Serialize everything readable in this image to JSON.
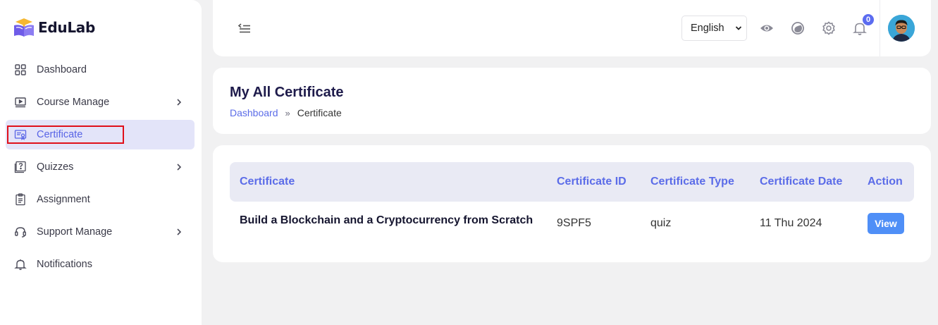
{
  "brand": {
    "name": "EduLab"
  },
  "sidebar": {
    "items": [
      {
        "label": "Dashboard",
        "icon": "grid-icon",
        "has_submenu": false,
        "active": false
      },
      {
        "label": "Course Manage",
        "icon": "play-screen-icon",
        "has_submenu": true,
        "active": false
      },
      {
        "label": "Certificate",
        "icon": "certificate-icon",
        "has_submenu": false,
        "active": true
      },
      {
        "label": "Quizzes",
        "icon": "quiz-icon",
        "has_submenu": true,
        "active": false
      },
      {
        "label": "Assignment",
        "icon": "clipboard-icon",
        "has_submenu": false,
        "active": false
      },
      {
        "label": "Support Manage",
        "icon": "headset-icon",
        "has_submenu": true,
        "active": false
      },
      {
        "label": "Notifications",
        "icon": "bell-icon",
        "has_submenu": false,
        "active": false
      }
    ]
  },
  "header": {
    "language": {
      "selected": "English"
    },
    "notifications_count": "0"
  },
  "page": {
    "title": "My All Certificate",
    "breadcrumb": {
      "home": "Dashboard",
      "separator": "»",
      "current": "Certificate"
    }
  },
  "table": {
    "columns": [
      "Certificate",
      "Certificate ID",
      "Certificate Type",
      "Certificate Date",
      "Action"
    ],
    "rows": [
      {
        "certificate": "Build a Blockchain and a Cryptocurrency from Scratch",
        "id": "9SPF5",
        "type": "quiz",
        "date": "11 Thu 2024",
        "action": "View"
      }
    ]
  },
  "colors": {
    "accent": "#5b6ce8",
    "active_bg": "#e3e4f9",
    "view_button": "#4f8ff7",
    "badge": "#5b6cf0",
    "highlight_border": "#e0101a"
  }
}
